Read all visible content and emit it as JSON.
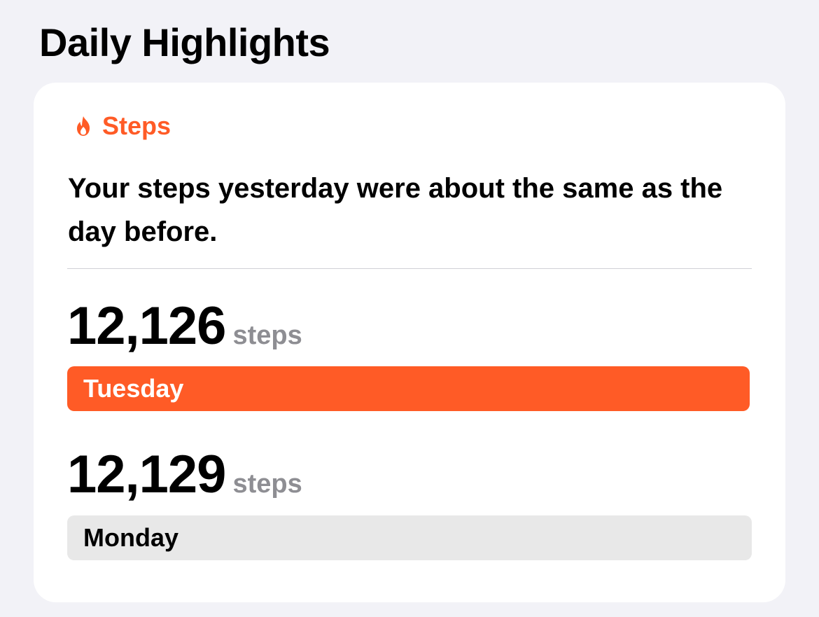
{
  "section": {
    "title": "Daily Highlights"
  },
  "card": {
    "category": {
      "icon": "flame-icon",
      "label": "Steps",
      "color": "#ff5b26"
    },
    "headline": "Your steps yesterday were about the same as the day before.",
    "comparisons": [
      {
        "value": "12,126",
        "unit": "steps",
        "day": "Tuesday",
        "bar_color": "#ff5b26",
        "text_color": "#ffffff",
        "relative_level": 0.9975
      },
      {
        "value": "12,129",
        "unit": "steps",
        "day": "Monday",
        "bar_color": "#e8e8e8",
        "text_color": "#000000",
        "relative_level": 1.0
      }
    ]
  },
  "colors": {
    "background": "#f2f2f7",
    "card": "#ffffff",
    "accent": "#ff5b26",
    "secondary_text": "#8e8e93",
    "divider": "#d1d1d6"
  }
}
